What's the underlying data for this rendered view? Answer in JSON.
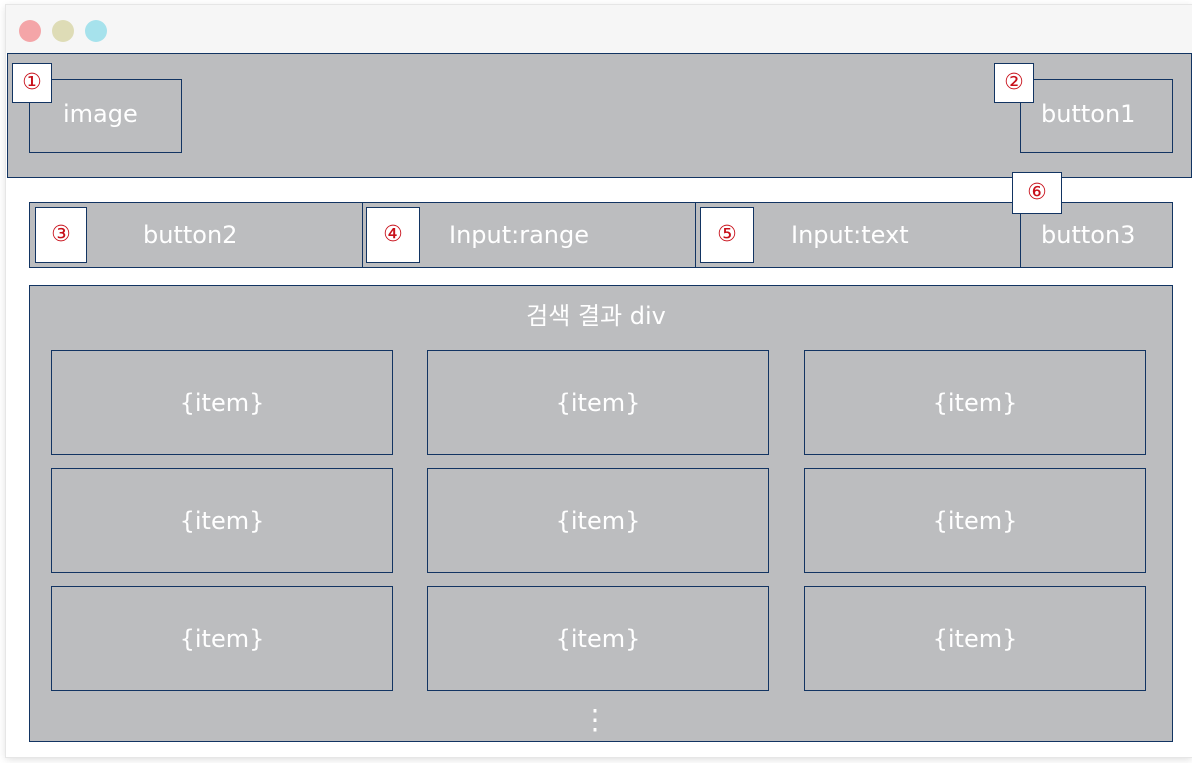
{
  "window": {
    "controls": [
      "close",
      "minimize",
      "maximize"
    ]
  },
  "header": {
    "image_label": "image",
    "button1_label": "button1",
    "badge_1": "①",
    "badge_2": "②"
  },
  "toolbar": {
    "button2_label": "button2",
    "range_label": "Input:range",
    "text_label": "Input:text",
    "button3_label": "button3",
    "badge_3": "③",
    "badge_4": "④",
    "badge_5": "⑤",
    "badge_6": "⑥"
  },
  "results": {
    "title": "검색 결과 div",
    "items": [
      "{item}",
      "{item}",
      "{item}",
      "{item}",
      "{item}",
      "{item}",
      "{item}",
      "{item}",
      "{item}"
    ],
    "more_indicator": "⋮"
  },
  "colors": {
    "panel_gray": "#bcbdbf",
    "border_navy": "#123462",
    "badge_red": "#c8101a"
  }
}
